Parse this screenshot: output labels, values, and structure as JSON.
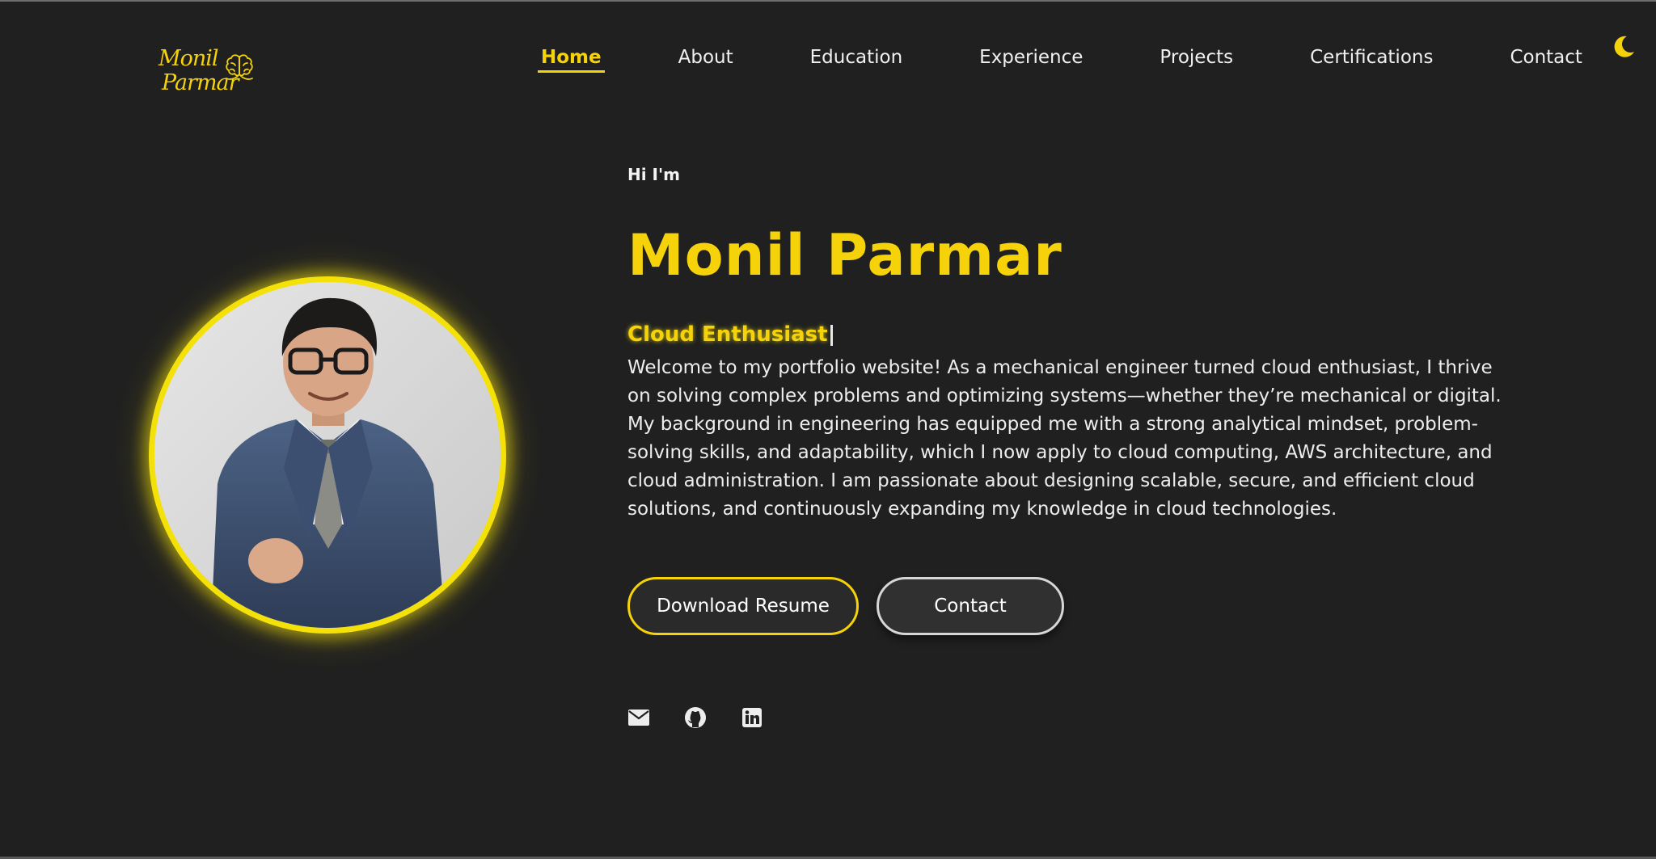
{
  "logo": {
    "line1": "Monil",
    "line2": "Parmar",
    "icon": "brain-icon"
  },
  "nav": {
    "items": [
      {
        "label": "Home",
        "active": true
      },
      {
        "label": "About"
      },
      {
        "label": "Education"
      },
      {
        "label": "Experience"
      },
      {
        "label": "Projects"
      },
      {
        "label": "Certifications"
      },
      {
        "label": "Contact"
      }
    ],
    "theme_toggle_icon": "moon-icon"
  },
  "hero": {
    "greeting": "Hi I'm",
    "name": "Monil Parmar",
    "role": "Cloud Enthusiast",
    "bio": "Welcome to my portfolio website! As a mechanical engineer turned cloud enthusiast, I thrive on solving complex problems and optimizing systems—whether they’re mechanical or digital. My background in engineering has equipped me with a strong analytical mindset, problem-solving skills, and adaptability, which I now apply to cloud computing, AWS architecture, and cloud administration. I am passionate about designing scalable, secure, and efficient cloud solutions, and continuously expanding my knowledge in cloud technologies.",
    "buttons": {
      "resume": "Download Resume",
      "contact": "Contact"
    },
    "socials": [
      "mail-icon",
      "github-icon",
      "linkedin-icon"
    ]
  },
  "colors": {
    "background": "#202020",
    "accent": "#f5d20a",
    "text": "#ececec"
  }
}
